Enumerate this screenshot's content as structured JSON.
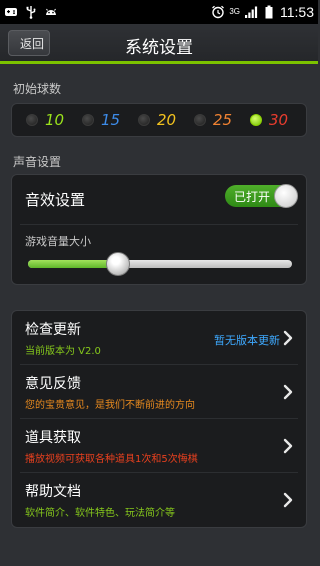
{
  "statusbar": {
    "time": "11:53",
    "network": "3G"
  },
  "header": {
    "back_label": "返回",
    "title": "系统设置"
  },
  "balls": {
    "section_label": "初始球数",
    "options": [
      {
        "label": "10",
        "color": "#9ae21c",
        "selected": false
      },
      {
        "label": "15",
        "color": "#3d8be8",
        "selected": false
      },
      {
        "label": "20",
        "color": "#f2c21f",
        "selected": false
      },
      {
        "label": "25",
        "color": "#f08232",
        "selected": false
      },
      {
        "label": "30",
        "color": "#e83c2e",
        "selected": true
      }
    ]
  },
  "sound": {
    "section_label": "声音设置",
    "effects_label": "音效设置",
    "toggle_label": "已打开",
    "volume_label": "游戏音量大小",
    "volume_level": 0.34
  },
  "list": [
    {
      "title": "检查更新",
      "subtitle": "当前版本为 V2.0",
      "subtitle_color": "#86c81c",
      "right_text": "暂无版本更新"
    },
    {
      "title": "意见反馈",
      "subtitle": "您的宝贵意见，是我们不断前进的方向",
      "subtitle_color": "#e88a1e",
      "right_text": ""
    },
    {
      "title": "道具获取",
      "subtitle": "播放视频可获取各种道具1次和5次悔棋",
      "subtitle_color": "#e8401e",
      "right_text": ""
    },
    {
      "title": "帮助文档",
      "subtitle": "软件简介、软件特色、玩法简介等",
      "subtitle_color": "#86c81c",
      "right_text": ""
    }
  ],
  "colors": {
    "accent": "#7cc200",
    "link": "#3ea9ff"
  }
}
